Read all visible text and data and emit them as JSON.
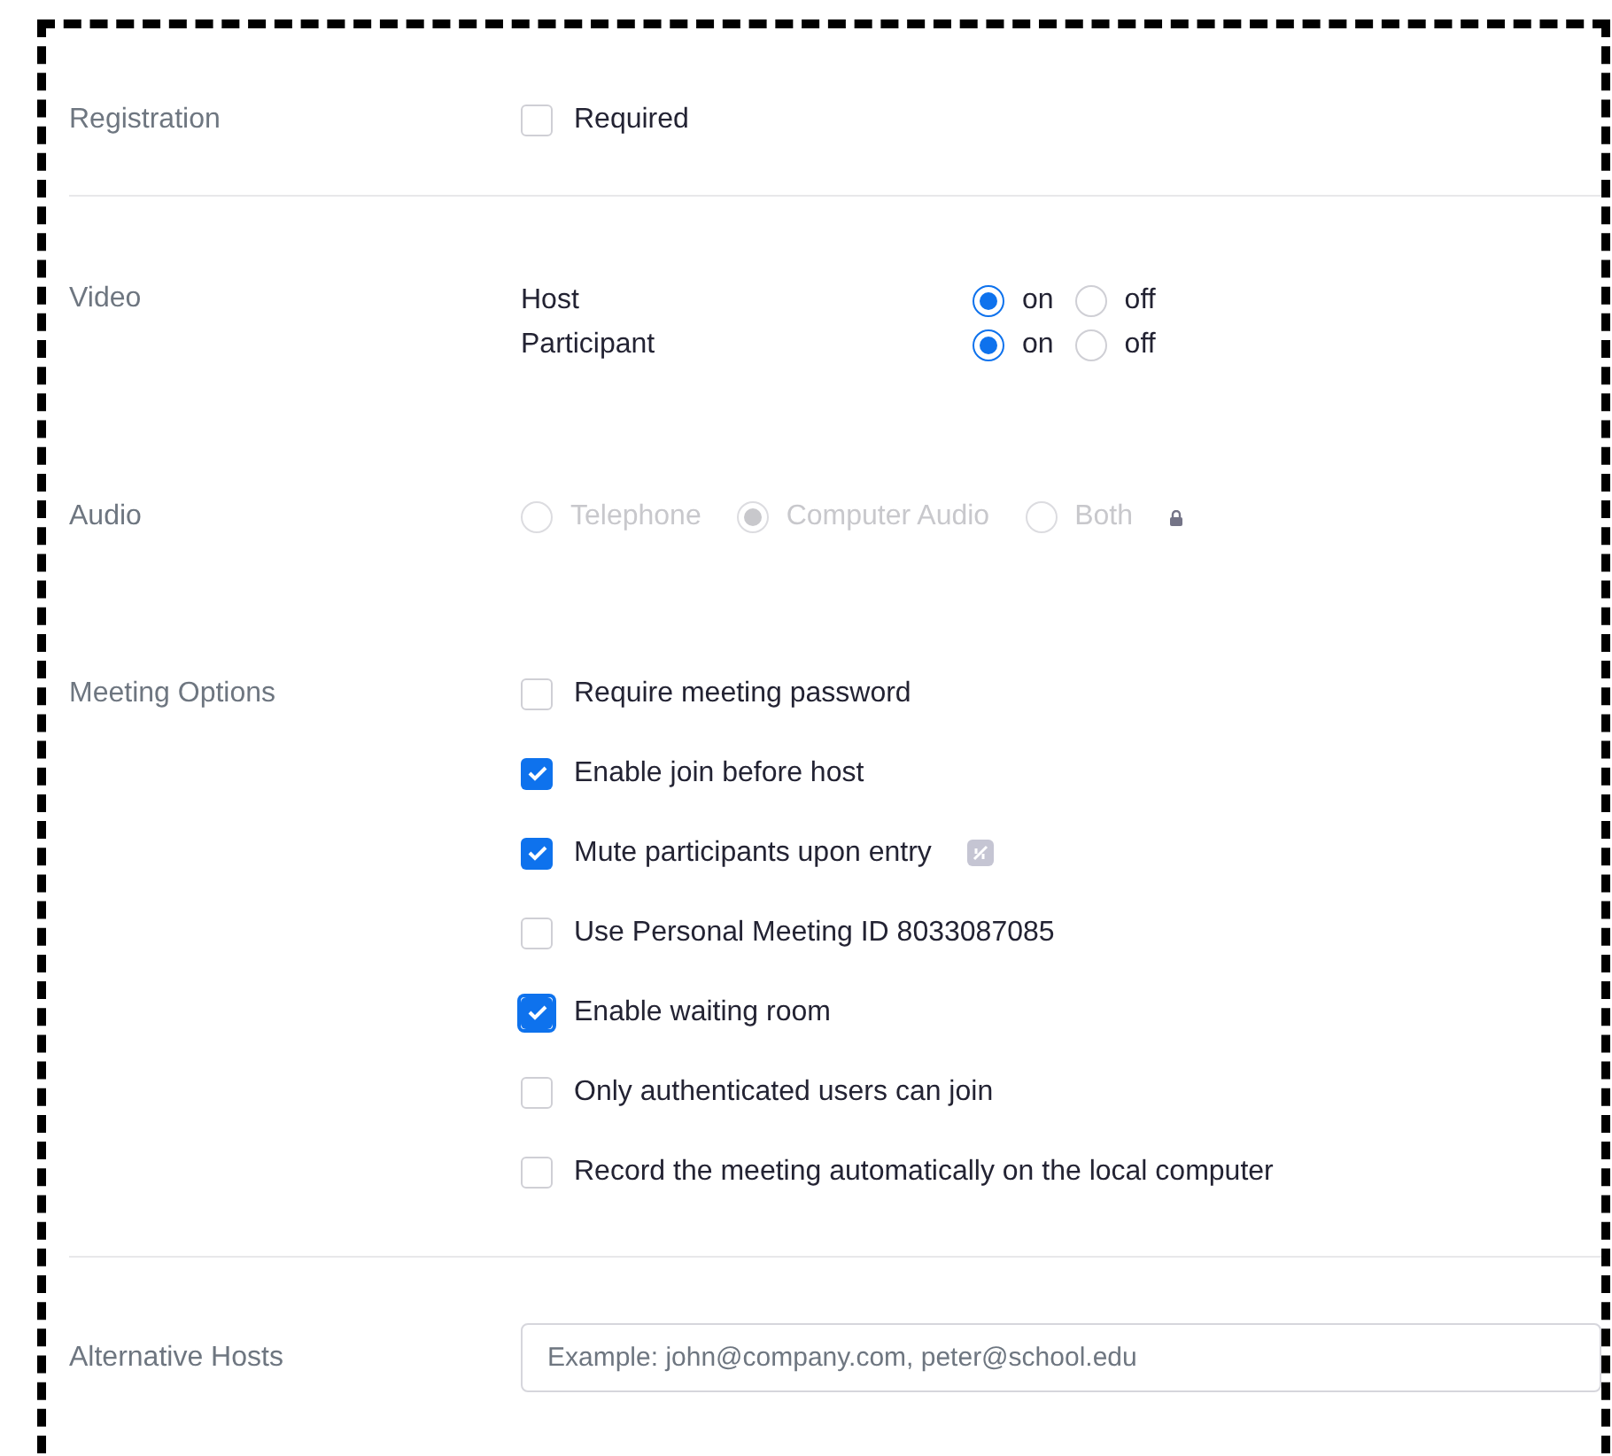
{
  "registration": {
    "label": "Registration",
    "option": {
      "label": "Required",
      "checked": false
    }
  },
  "video": {
    "label": "Video",
    "rows": [
      {
        "label": "Host",
        "options": [
          {
            "label": "on",
            "selected": true
          },
          {
            "label": "off",
            "selected": false
          }
        ]
      },
      {
        "label": "Participant",
        "options": [
          {
            "label": "on",
            "selected": true
          },
          {
            "label": "off",
            "selected": false
          }
        ]
      }
    ]
  },
  "audio": {
    "label": "Audio",
    "disabled": true,
    "locked": true,
    "options": [
      {
        "label": "Telephone",
        "selected": false
      },
      {
        "label": "Computer Audio",
        "selected": true
      },
      {
        "label": "Both",
        "selected": false
      }
    ]
  },
  "meeting_options": {
    "label": "Meeting Options",
    "items": [
      {
        "label": "Require meeting password",
        "checked": false,
        "focused": false,
        "info": false
      },
      {
        "label": "Enable join before host",
        "checked": true,
        "focused": false,
        "info": false
      },
      {
        "label": "Mute participants upon entry",
        "checked": true,
        "focused": false,
        "info": true
      },
      {
        "label": "Use Personal Meeting ID 8033087085",
        "checked": false,
        "focused": false,
        "info": false
      },
      {
        "label": "Enable waiting room",
        "checked": true,
        "focused": true,
        "info": false
      },
      {
        "label": "Only authenticated users can join",
        "checked": false,
        "focused": false,
        "info": false
      },
      {
        "label": "Record the meeting automatically on the local computer",
        "checked": false,
        "focused": false,
        "info": false
      }
    ]
  },
  "alternative_hosts": {
    "label": "Alternative Hosts",
    "placeholder": "Example: john@company.com, peter@school.edu"
  }
}
